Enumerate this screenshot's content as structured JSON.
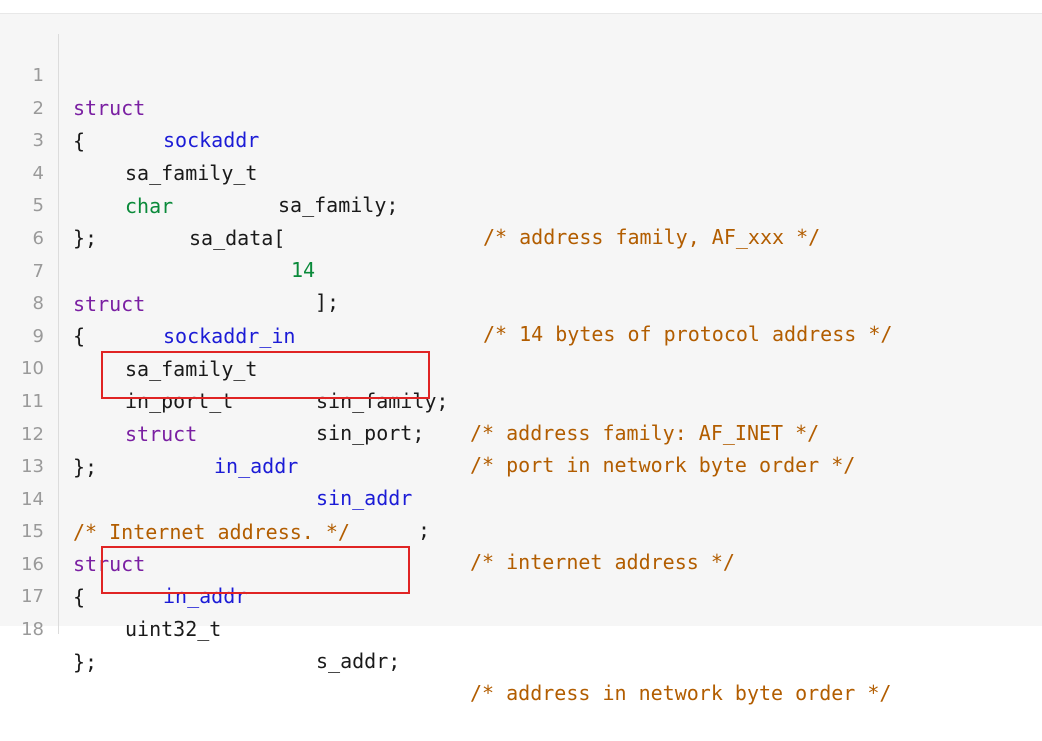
{
  "colors": {
    "keyword": "#7a1fa2",
    "identifier_type": "#1b1bd6",
    "builtin_type": "#0a8a3a",
    "number": "#0a8a3a",
    "comment": "#b25d00",
    "text": "#1a1a1a",
    "line_number": "#9a9a9a",
    "highlight_border": "#e02424",
    "background": "#f6f6f6"
  },
  "code": {
    "line_numbers": [
      "1",
      "2",
      "3",
      "4",
      "5",
      "6",
      "7",
      "8",
      "9",
      "10",
      "11",
      "12",
      "13",
      "14",
      "15",
      "16",
      "17",
      "18"
    ],
    "l1": {
      "kw": "struct",
      "name": "sockaddr"
    },
    "l2": {
      "text": "{"
    },
    "l3": {
      "type": "sa_family_t",
      "field": "sa_family;",
      "comment": "/* address family, AF_xxx */"
    },
    "l4": {
      "type": "char",
      "field": "sa_data[",
      "num": "14",
      "tail": "];",
      "comment": "/* 14 bytes of protocol address */"
    },
    "l5": {
      "text": "};"
    },
    "l7": {
      "kw": "struct",
      "name": "sockaddr_in"
    },
    "l8": {
      "text": "{"
    },
    "l9": {
      "type": "sa_family_t",
      "field": "sin_family;",
      "comment": "/* address family: AF_INET */"
    },
    "l10": {
      "type": "in_port_t",
      "field": "sin_port;",
      "comment": "/* port in network byte order */"
    },
    "l11": {
      "kw": "struct",
      "type": "in_addr",
      "field": "sin_addr",
      "tail": ";",
      "comment": "/* internet address */"
    },
    "l12": {
      "text": "};"
    },
    "l14": {
      "comment": "/* Internet address. */"
    },
    "l15": {
      "kw": "struct",
      "name": "in_addr"
    },
    "l16": {
      "text": "{"
    },
    "l17": {
      "type": "uint32_t",
      "field": "s_addr;",
      "comment": "/* address in network byte order */"
    },
    "l18": {
      "text": "};"
    }
  }
}
